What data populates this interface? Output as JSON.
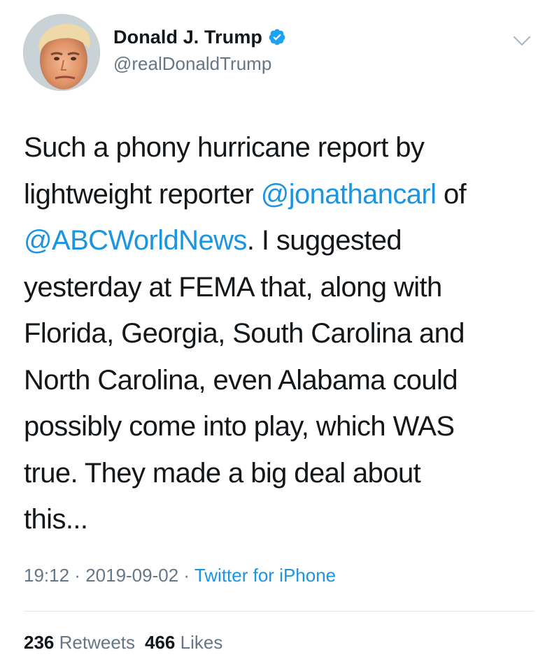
{
  "author": {
    "display_name": "Donald J. Trump",
    "handle": "@realDonaldTrump",
    "verified": true,
    "verified_color": "#1da1f2"
  },
  "tweet": {
    "segments": [
      {
        "text": "Such a phony hurricane report by\nlightweight reporter ",
        "type": "text"
      },
      {
        "text": "@jonathancarl",
        "type": "mention"
      },
      {
        "text": " of\n",
        "type": "text"
      },
      {
        "text": "@ABCWorldNews",
        "type": "mention"
      },
      {
        "text": ". I suggested\nyesterday at FEMA that, along with\nFlorida, Georgia, South Carolina and\nNorth Carolina, even Alabama could\npossibly come into play, which WAS\ntrue. They made a big deal about\nthis...",
        "type": "text"
      }
    ]
  },
  "meta": {
    "time": "19:12",
    "separator": " · ",
    "date": "2019-09-02",
    "source": "Twitter for iPhone"
  },
  "stats": {
    "retweets_count": "236",
    "retweets_label": "Retweets",
    "likes_count": "466",
    "likes_label": "Likes"
  },
  "icons": {
    "avatar": "profile-photo",
    "verified": "verified-badge-icon",
    "caret": "chevron-down-icon"
  },
  "colors": {
    "link": "#1b95e0",
    "secondary_text": "#657786",
    "primary_text": "#14171a",
    "divider": "#e1e8ed"
  }
}
